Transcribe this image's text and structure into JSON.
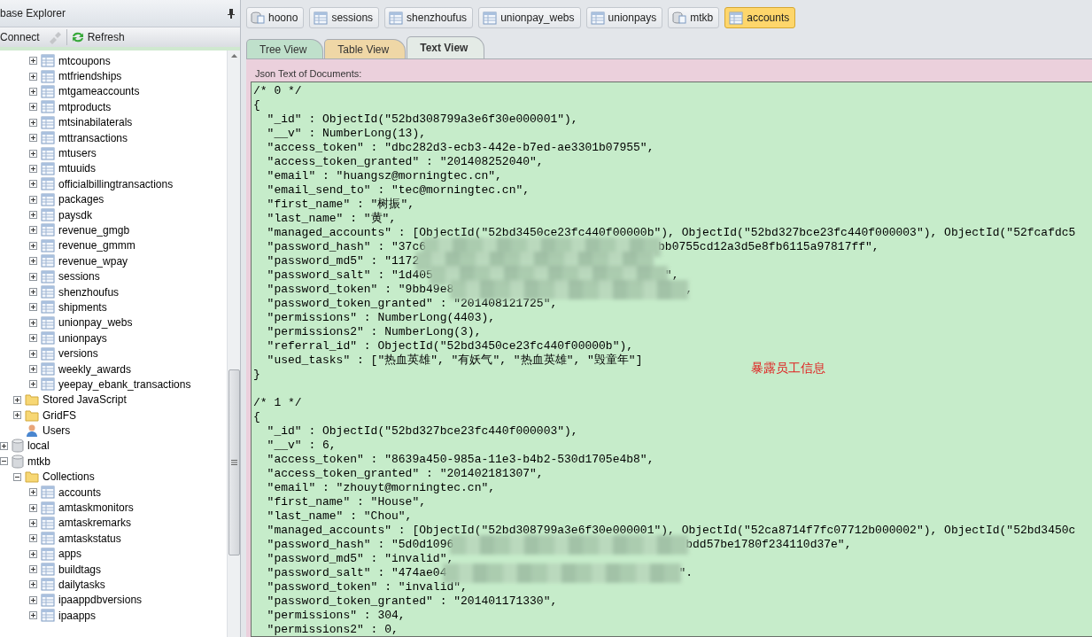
{
  "explorer": {
    "title": "base Explorer",
    "toolbar": [
      {
        "kind": "connect",
        "label": "Connect",
        "disabled": false
      },
      {
        "kind": "plug",
        "disabled": true
      },
      {
        "kind": "refresh",
        "label": "Refresh",
        "disabled": false
      }
    ],
    "tree": [
      {
        "kind": "continued",
        "children": [
          {
            "kind": "continued",
            "children": [
              {
                "kind": "collection",
                "label": "mtcoupons",
                "expanded": false
              },
              {
                "kind": "collection",
                "label": "mtfriendships",
                "expanded": false
              },
              {
                "kind": "collection",
                "label": "mtgameaccounts",
                "expanded": false
              },
              {
                "kind": "collection",
                "label": "mtproducts",
                "expanded": false
              },
              {
                "kind": "collection",
                "label": "mtsinabilaterals",
                "expanded": false
              },
              {
                "kind": "collection",
                "label": "mttransactions",
                "expanded": false
              },
              {
                "kind": "collection",
                "label": "mtusers",
                "expanded": false
              },
              {
                "kind": "collection",
                "label": "mtuuids",
                "expanded": false
              },
              {
                "kind": "collection",
                "label": "officialbillingtransactions",
                "expanded": false
              },
              {
                "kind": "collection",
                "label": "packages",
                "expanded": false
              },
              {
                "kind": "collection",
                "label": "paysdk",
                "expanded": false
              },
              {
                "kind": "collection",
                "label": "revenue_gmgb",
                "expanded": false
              },
              {
                "kind": "collection",
                "label": "revenue_gmmm",
                "expanded": false
              },
              {
                "kind": "collection",
                "label": "revenue_wpay",
                "expanded": false
              },
              {
                "kind": "collection",
                "label": "sessions",
                "expanded": false
              },
              {
                "kind": "collection",
                "label": "shenzhoufus",
                "expanded": false
              },
              {
                "kind": "collection",
                "label": "shipments",
                "expanded": false
              },
              {
                "kind": "collection",
                "label": "unionpay_webs",
                "expanded": false
              },
              {
                "kind": "collection",
                "label": "unionpays",
                "expanded": false
              },
              {
                "kind": "collection",
                "label": "versions",
                "expanded": false
              },
              {
                "kind": "collection",
                "label": "weekly_awards",
                "expanded": false
              },
              {
                "kind": "collection",
                "label": "yeepay_ebank_transactions",
                "expanded": false
              }
            ]
          },
          {
            "kind": "folder",
            "label": "Stored JavaScript",
            "expanded": false
          },
          {
            "kind": "folder",
            "label": "GridFS",
            "expanded": false
          },
          {
            "kind": "users",
            "label": "Users"
          }
        ]
      },
      {
        "kind": "database",
        "label": "local",
        "expanded": false
      },
      {
        "kind": "database",
        "label": "mtkb",
        "expanded": true,
        "children": [
          {
            "kind": "folder",
            "label": "Collections",
            "expanded": true,
            "children": [
              {
                "kind": "collection",
                "label": "accounts",
                "expanded": false
              },
              {
                "kind": "collection",
                "label": "amtaskmonitors",
                "expanded": false
              },
              {
                "kind": "collection",
                "label": "amtaskremarks",
                "expanded": false
              },
              {
                "kind": "collection",
                "label": "amtaskstatus",
                "expanded": false
              },
              {
                "kind": "collection",
                "label": "apps",
                "expanded": false
              },
              {
                "kind": "collection",
                "label": "buildtags",
                "expanded": false
              },
              {
                "kind": "collection",
                "label": "dailytasks",
                "expanded": false
              },
              {
                "kind": "collection",
                "label": "ipaappdbversions",
                "expanded": false
              },
              {
                "kind": "collection",
                "label": "ipaapps",
                "expanded": false
              }
            ]
          }
        ]
      }
    ]
  },
  "doc_tabs": [
    {
      "kind": "database",
      "label": "hoono",
      "selected": false
    },
    {
      "kind": "collection",
      "label": "sessions",
      "selected": false
    },
    {
      "kind": "collection",
      "label": "shenzhoufus",
      "selected": false
    },
    {
      "kind": "collection",
      "label": "unionpay_webs",
      "selected": false
    },
    {
      "kind": "collection",
      "label": "unionpays",
      "selected": false
    },
    {
      "kind": "database",
      "label": "mtkb",
      "selected": false
    },
    {
      "kind": "collection",
      "label": "accounts",
      "selected": true
    }
  ],
  "view_tabs": [
    {
      "label": "Tree View",
      "selected": false,
      "color": "#bfe0cb"
    },
    {
      "label": "Table View",
      "selected": false,
      "color": "#efd7a6"
    },
    {
      "label": "Text View",
      "selected": true,
      "color": "#e4ebe6"
    }
  ],
  "text_panel": {
    "label": "Json Text of Documents:",
    "documents": [
      {
        "header": "/* 0 */",
        "open": "{",
        "fields": [
          {
            "text": "\"_id\" : ObjectId(\"52bd308799a3e6f30e000001\"),"
          },
          {
            "text": "\"__v\" : NumberLong(13),"
          },
          {
            "text": "\"access_token\" : \"dbc282d3-ecb3-442e-b7ed-ae3301b07955\","
          },
          {
            "text": "\"access_token_granted\" : \"201408252040\","
          },
          {
            "text": "\"email\" : \"huangsz@morningtec.cn\","
          },
          {
            "text": "\"email_send_to\" : \"tec@morningtec.cn\","
          },
          {
            "text": "\"first_name\" : \"树振\","
          },
          {
            "text": "\"last_name\" : \"黄\","
          },
          {
            "text": "\"managed_accounts\" : [ObjectId(\"52bd3450ce23fc440f00000b\"), ObjectId(\"52bd327bce23fc440f000003\"), ObjectId(\"52fcafdc5"
          },
          {
            "text": "\"password_hash\" : \"37c6",
            "redacted": true,
            "tail": "bb0755cd12a3d5e8fb6115a97817ff\","
          },
          {
            "text": "\"password_md5\" : \"1172",
            "redacted": true
          },
          {
            "text": "\"password_salt\" : \"1d405",
            "redacted": true,
            "tail": "\","
          },
          {
            "text": "\"password_token\" : \"9bb49e8",
            "redacted": true,
            "tail": ","
          },
          {
            "text": "\"password_token_granted\" : \"201408121725\","
          },
          {
            "text": "\"permissions\" : NumberLong(4403),"
          },
          {
            "text": "\"permissions2\" : NumberLong(3),"
          },
          {
            "text": "\"referral_id\" : ObjectId(\"52bd3450ce23fc440f00000b\"),"
          },
          {
            "text": "\"used_tasks\" : [\"热血英雄\", \"有妖气\", \"热血英雄\", \"毁童年\"]"
          }
        ],
        "close": "}"
      },
      {
        "header": "/* 1 */",
        "open": "{",
        "fields": [
          {
            "text": "\"_id\" : ObjectId(\"52bd327bce23fc440f000003\"),"
          },
          {
            "text": "\"__v\" : 6,"
          },
          {
            "text": "\"access_token\" : \"8639a450-985a-11e3-b4b2-530d1705e4b8\","
          },
          {
            "text": "\"access_token_granted\" : \"201402181307\","
          },
          {
            "text": "\"email\" : \"zhouyt@morningtec.cn\","
          },
          {
            "text": "\"first_name\" : \"House\","
          },
          {
            "text": "\"last_name\" : \"Chou\","
          },
          {
            "text": "\"managed_accounts\" : [ObjectId(\"52bd308799a3e6f30e000001\"), ObjectId(\"52ca8714f7fc07712b000002\"), ObjectId(\"52bd3450c"
          },
          {
            "text": "\"password_hash\" : \"5d0d1096",
            "redacted": true,
            "tail": "bdd57be1780f234110d37e\","
          },
          {
            "text": "\"password_md5\" : \"invalid\","
          },
          {
            "text": "\"password_salt\" : \"474ae04",
            "redacted": true,
            "tail": "\"."
          },
          {
            "text": "\"password_token\" : \"invalid\","
          },
          {
            "text": "\"password_token_granted\" : \"201401171330\","
          },
          {
            "text": "\"permissions\" : 304,"
          },
          {
            "text": "\"permissions2\" : 0,"
          }
        ]
      }
    ]
  },
  "annotation": {
    "text": "暴露员工信息"
  }
}
